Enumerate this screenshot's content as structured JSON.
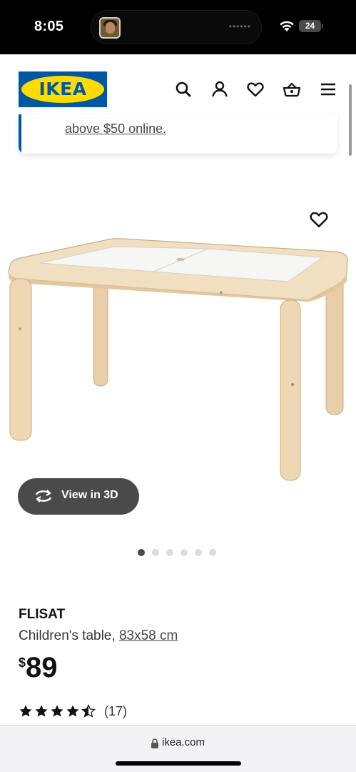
{
  "status_bar": {
    "time": "8:05",
    "battery": "24",
    "icons": [
      "wifi-icon",
      "battery-icon"
    ]
  },
  "header": {
    "logo_text": "IKEA",
    "icons": [
      "search-icon",
      "account-icon",
      "heart-icon",
      "basket-icon",
      "menu-icon"
    ]
  },
  "banner": {
    "text": "above $50 online."
  },
  "product": {
    "name": "FLISAT",
    "description": "Children's table, ",
    "size_link": "83x58 cm",
    "currency": "$",
    "price": "89",
    "rating_value": 4.5,
    "rating_count": "(17)",
    "view3d_label": "View in 3D",
    "image_count": 6,
    "active_image": 1
  },
  "browser": {
    "url": "ikea.com"
  },
  "colors": {
    "brand_blue": "#0058a3",
    "brand_yellow": "#ffdb00",
    "pill_bg": "#4a4a4a"
  }
}
